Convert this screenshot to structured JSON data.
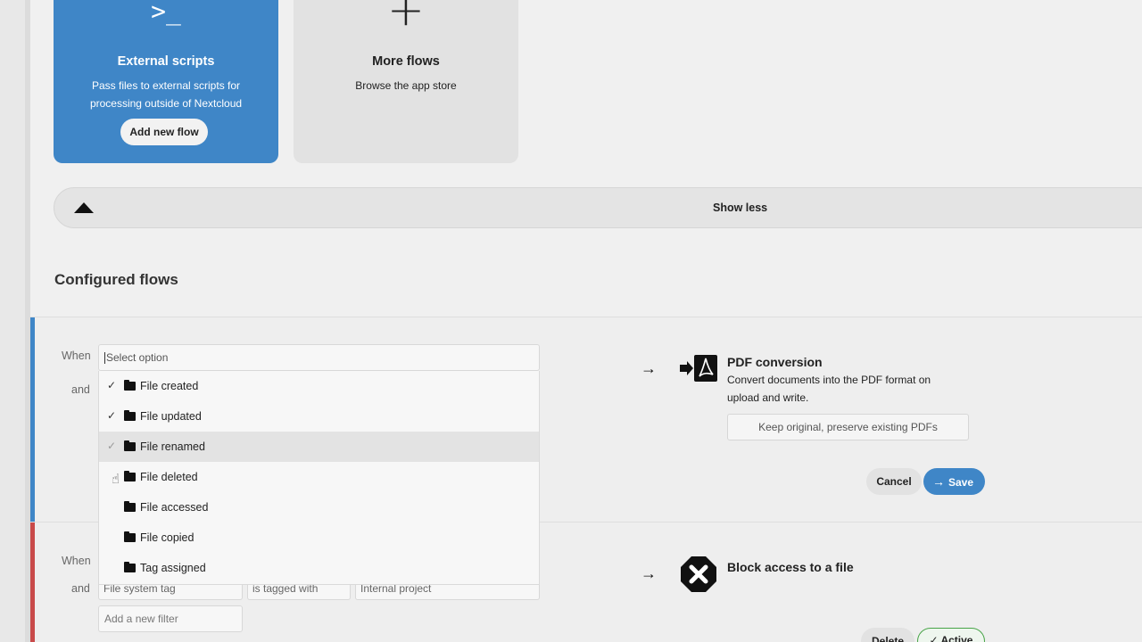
{
  "cards": {
    "external": {
      "icon": "terminal-icon",
      "icon_glyph": ">_",
      "title": "External scripts",
      "description": "Pass files to external scripts for processing outside of Nextcloud",
      "button": "Add new flow"
    },
    "more": {
      "icon": "plus-icon",
      "icon_glyph": "+",
      "title": "More flows",
      "description": "Browse the app store"
    }
  },
  "show_less": {
    "label": "Show less",
    "icon": "triangle-up-icon"
  },
  "section_title": "Configured flows",
  "flow1": {
    "when_label": "When",
    "and_label": "and",
    "select_placeholder": "Select option",
    "options": [
      {
        "label": "File created",
        "checked": true,
        "highlighted": false
      },
      {
        "label": "File updated",
        "checked": true,
        "highlighted": false
      },
      {
        "label": "File renamed",
        "checked": true,
        "highlighted": true
      },
      {
        "label": "File deleted",
        "checked": false,
        "highlighted": false
      },
      {
        "label": "File accessed",
        "checked": false,
        "highlighted": false
      },
      {
        "label": "File copied",
        "checked": false,
        "highlighted": false
      },
      {
        "label": "Tag assigned",
        "checked": false,
        "highlighted": false
      }
    ],
    "arrow": "→",
    "operation": {
      "icon": "pdf-icon",
      "title": "PDF conversion",
      "description": "Convert documents into the PDF format on upload and write.",
      "mode_value": "Keep original, preserve existing PDFs"
    },
    "cancel_label": "Cancel",
    "save_label": "Save",
    "accent": "#3f86c7"
  },
  "flow2": {
    "when_label": "When",
    "and_label": "and",
    "filter_check": "File system tag",
    "filter_operator": "is tagged with",
    "filter_value": "Internal project",
    "add_filter_placeholder": "Add a new filter",
    "arrow": "→",
    "operation": {
      "icon": "block-icon",
      "title": "Block access to a file"
    },
    "delete_label": "Delete",
    "active_label": "Active",
    "accent": "#c94a4a"
  }
}
